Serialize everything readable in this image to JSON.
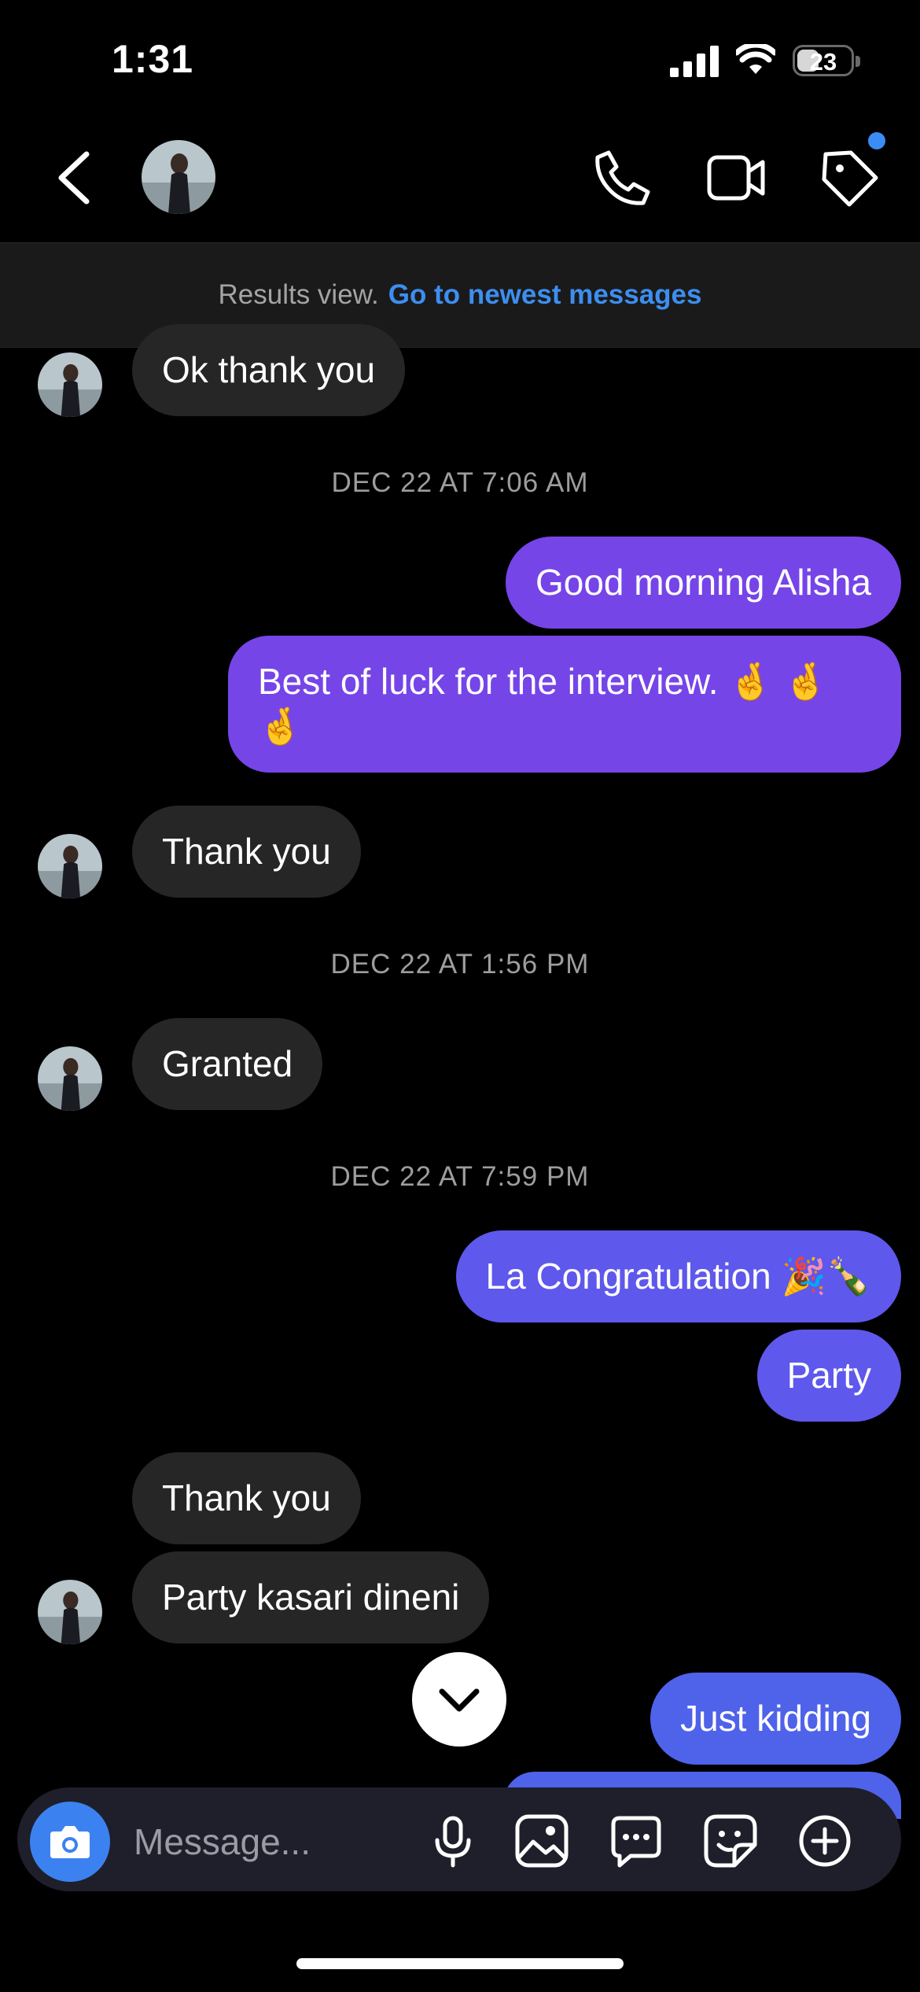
{
  "status_bar": {
    "time": "1:31",
    "battery": "23"
  },
  "banner": {
    "prefix": "Results view.",
    "link": "Go to newest messages"
  },
  "messages": {
    "m1": "Ok thank you",
    "d1": "DEC 22 AT 7:06 AM",
    "m2": "Good morning Alisha",
    "m3_line1": "Best of luck for the interview. 🤞 🤞",
    "m3_line2": "🤞",
    "m4": "Thank you",
    "d2": "DEC 22 AT 1:56 PM",
    "m5": "Granted",
    "d3": "DEC 22 AT 7:59 PM",
    "m6": "La Congratulation 🎉🍾",
    "m7": "Party",
    "m8": "Thank you",
    "m9": "Party kasari dineni",
    "m10": "Just kidding"
  },
  "composer": {
    "placeholder": "Message..."
  },
  "icons": {
    "back": "chevron-left-icon",
    "call": "phone-icon",
    "video": "video-camera-icon",
    "tag": "tag-icon",
    "camera": "camera-icon",
    "mic": "microphone-icon",
    "gallery": "image-icon",
    "chat": "chat-bubble-icon",
    "sticker": "sticker-icon",
    "plus": "plus-circle-icon",
    "scroll": "chevron-down-icon"
  },
  "colors": {
    "background": "#000000",
    "incoming_bubble": "#262626",
    "outgoing_purple": "#7545e8",
    "outgoing_blue": "#4f62ea",
    "link": "#3d8ef0",
    "accent": "#3b82f0"
  }
}
